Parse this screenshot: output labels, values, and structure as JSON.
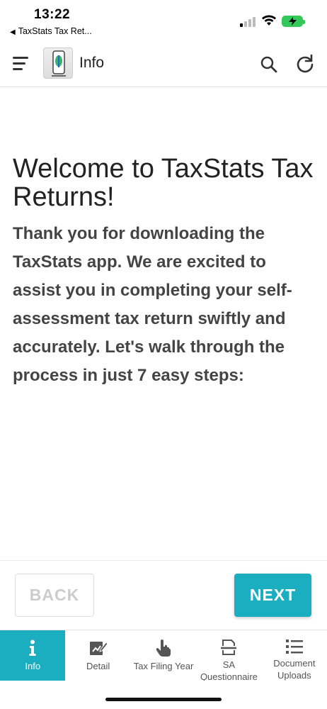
{
  "status": {
    "time": "13:22",
    "back_app": "TaxStats Tax Ret..."
  },
  "header": {
    "title": "Info",
    "icons": [
      "menu-icon",
      "app-logo",
      "search-icon",
      "refresh-icon"
    ]
  },
  "content": {
    "title": "Welcome to TaxStats Tax Returns!",
    "body": "Thank you for downloading the TaxStats app. We are excited to assist you in completing your self-assessment tax return swiftly and accurately. Let's walk through the process in just 7 easy steps:"
  },
  "actions": {
    "back_label": "BACK",
    "next_label": "NEXT"
  },
  "nav": {
    "items": [
      {
        "label": "Info",
        "icon": "info-icon",
        "active": true
      },
      {
        "label": "Detail",
        "icon": "edit-icon",
        "active": false
      },
      {
        "label": "Tax Filing Year",
        "icon": "hand-pointer-icon",
        "active": false
      },
      {
        "label": "SA Questionnaire",
        "icon": "scan-document-icon",
        "active": false
      },
      {
        "label": "Document Uploads",
        "icon": "list-icon",
        "active": false
      }
    ]
  },
  "colors": {
    "accent": "#1aaec0",
    "battery": "#34c759"
  }
}
